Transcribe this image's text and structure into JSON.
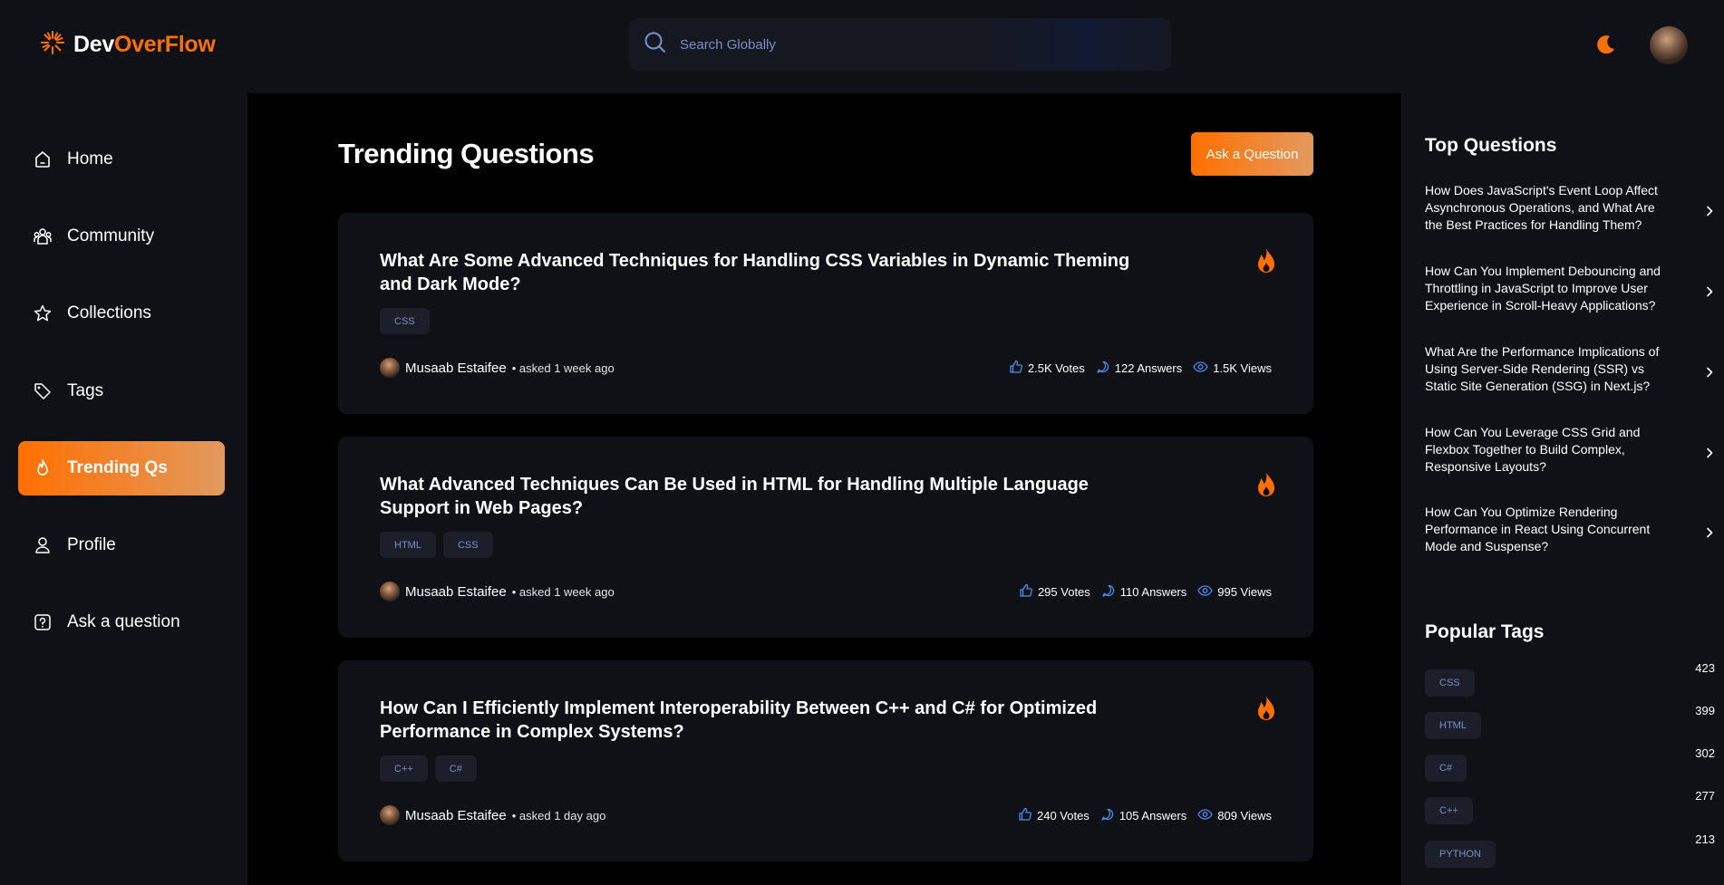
{
  "brand": {
    "part1": "Dev",
    "part2": "OverFlow"
  },
  "search": {
    "placeholder": "Search Globally"
  },
  "nav": [
    {
      "label": "Home",
      "icon": "home-icon"
    },
    {
      "label": "Community",
      "icon": "users-icon"
    },
    {
      "label": "Collections",
      "icon": "star-icon"
    },
    {
      "label": "Tags",
      "icon": "tag-icon"
    },
    {
      "label": "Trending Qs",
      "icon": "fire-icon",
      "active": true
    },
    {
      "label": "Profile",
      "icon": "user-icon"
    },
    {
      "label": "Ask a question",
      "icon": "question-icon"
    }
  ],
  "main": {
    "title": "Trending Questions",
    "ask_button": "Ask a Question",
    "questions": [
      {
        "title": "What Are Some Advanced Techniques for Handling CSS Variables in Dynamic Theming and Dark Mode?",
        "tags": [
          "CSS"
        ],
        "author": "Musaab Estaifee",
        "asked": "• asked 1 week ago",
        "votes": "2.5K Votes",
        "answers": "122 Answers",
        "views": "1.5K Views"
      },
      {
        "title": "What Advanced Techniques Can Be Used in HTML for Handling Multiple Language Support in Web Pages?",
        "tags": [
          "HTML",
          "CSS"
        ],
        "author": "Musaab Estaifee",
        "asked": "• asked 1 week ago",
        "votes": "295 Votes",
        "answers": "110 Answers",
        "views": "995 Views"
      },
      {
        "title": "How Can I Efficiently Implement Interoperability Between C++ and C# for Optimized Performance in Complex Systems?",
        "tags": [
          "C++",
          "C#"
        ],
        "author": "Musaab Estaifee",
        "asked": "• asked 1 day ago",
        "votes": "240 Votes",
        "answers": "105 Answers",
        "views": "809 Views"
      }
    ]
  },
  "right": {
    "top_title": "Top Questions",
    "top_questions": [
      "How Does JavaScript's Event Loop Affect Asynchronous Operations, and What Are the Best Practices for Handling Them?",
      "How Can You Implement Debouncing and Throttling in JavaScript to Improve User Experience in Scroll-Heavy Applications?",
      "What Are the Performance Implications of Using Server-Side Rendering (SSR) vs Static Site Generation (SSG) in Next.js?",
      "How Can You Leverage CSS Grid and Flexbox Together to Build Complex, Responsive Layouts?",
      "How Can You Optimize Rendering Performance in React Using Concurrent Mode and Suspense?"
    ],
    "tags_title": "Popular Tags",
    "popular_tags": [
      {
        "name": "CSS",
        "count": "423"
      },
      {
        "name": "HTML",
        "count": "399"
      },
      {
        "name": "C#",
        "count": "302"
      },
      {
        "name": "C++",
        "count": "277"
      },
      {
        "name": "PYTHON",
        "count": "213"
      }
    ]
  },
  "colors": {
    "accent": "#ff7000",
    "accent_end": "#e2995f",
    "panel": "#0f1117",
    "tag_bg": "#1c1f29",
    "tag_text": "#7b8ec8",
    "stat_icon": "#4a8fe7"
  }
}
